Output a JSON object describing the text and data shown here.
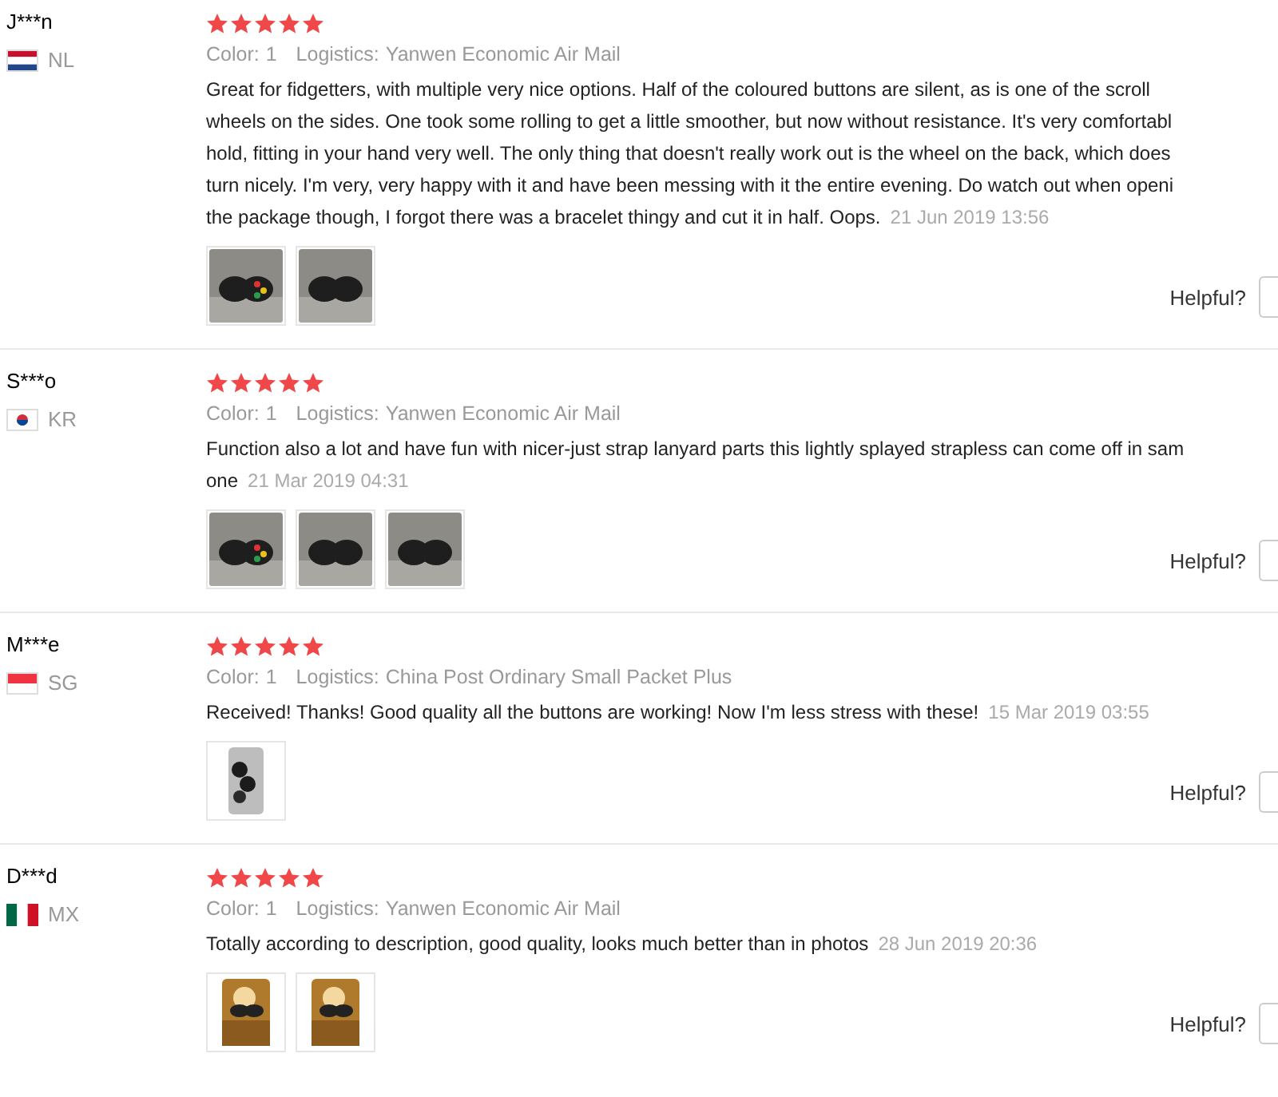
{
  "reviews": [
    {
      "name": "J***n",
      "country": "NL",
      "stars": 5,
      "color_label": "Color:",
      "color_value": "1",
      "logistics_label": "Logistics:",
      "logistics_value": "Yanwen Economic Air Mail",
      "lines": [
        "Great for fidgetters, with multiple very nice options. Half of the coloured buttons are silent, as is one of the scroll",
        "wheels on the sides. One took some rolling to get a little smoother, but now without resistance. It's very comfortabl",
        "hold, fitting in your hand very well. The only thing that doesn't really work out is the wheel on the back, which does",
        "turn nicely. I'm very, very happy with it and have been messing with it the entire evening. Do watch out when openi",
        "the package though, I forgot there was a bracelet thingy and cut it in half. Oops."
      ],
      "date": "21 Jun 2019 13:56",
      "photos": [
        {
          "kind": "picture"
        },
        {
          "kind": "picture"
        }
      ],
      "helpful": "Helpful?"
    },
    {
      "name": "S***o",
      "country": "KR",
      "stars": 5,
      "color_label": "Color:",
      "color_value": "1",
      "logistics_label": "Logistics:",
      "logistics_value": "Yanwen Economic Air Mail",
      "lines": [
        "Function also a lot and have fun with nicer-just strap lanyard parts this lightly splayed strapless can come off in sam",
        "one"
      ],
      "date": "21 Mar 2019 04:31",
      "photos": [
        {
          "kind": "picture"
        },
        {
          "kind": "picture"
        },
        {
          "kind": "picture"
        }
      ],
      "helpful": "Helpful?"
    },
    {
      "name": "M***e",
      "country": "SG",
      "stars": 5,
      "color_label": "Color:",
      "color_value": "1",
      "logistics_label": "Logistics:",
      "logistics_value": "China Post Ordinary Small Packet Plus",
      "lines": [
        "Received! Thanks! Good quality all the buttons are working! Now I'm less stress with these!"
      ],
      "date": "15 Mar 2019 03:55",
      "photos": [
        {
          "kind": "picture"
        }
      ],
      "helpful": "Helpful?"
    },
    {
      "name": "D***d",
      "country": "MX",
      "stars": 5,
      "color_label": "Color:",
      "color_value": "1",
      "logistics_label": "Logistics:",
      "logistics_value": "Yanwen Economic Air Mail",
      "lines": [
        "Totally according to description, good quality, looks much better than in photos"
      ],
      "date": "28 Jun 2019 20:36",
      "photos": [
        {
          "kind": "picture"
        },
        {
          "kind": "picture"
        }
      ],
      "helpful": "Helpful?"
    }
  ]
}
